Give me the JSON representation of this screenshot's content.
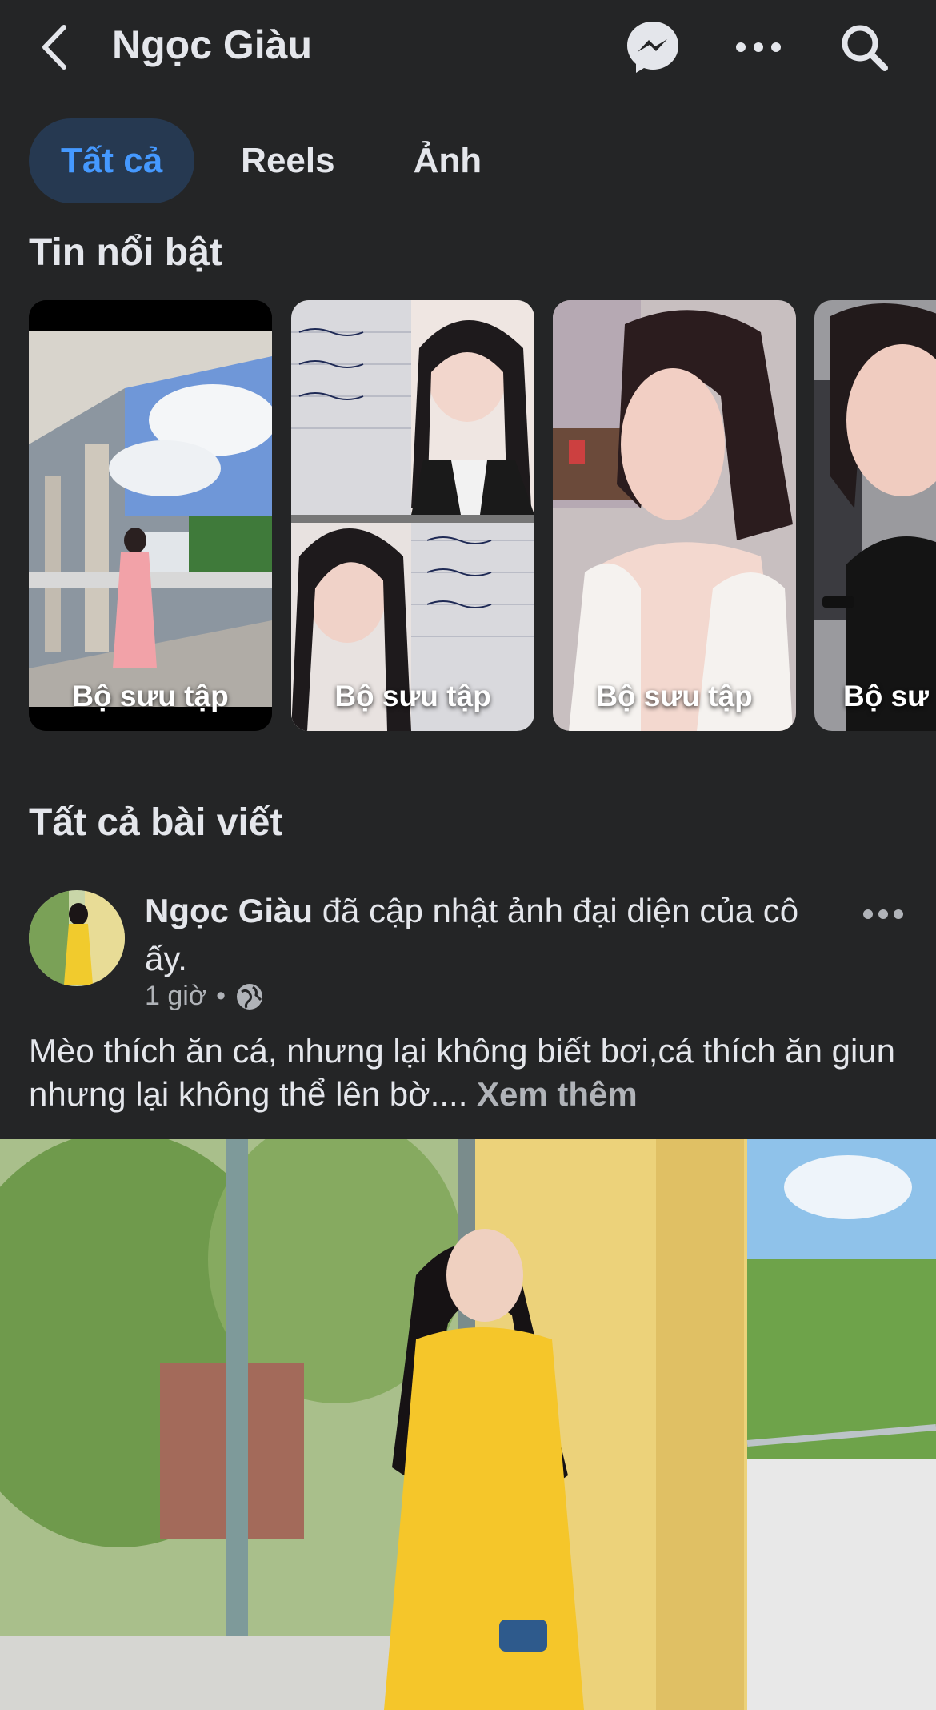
{
  "header": {
    "title": "Ngọc Giàu",
    "icons": [
      "back-chevron-icon",
      "messenger-icon",
      "more-horizontal-icon",
      "search-icon"
    ]
  },
  "tabs": [
    {
      "label": "Tất cả",
      "active": true
    },
    {
      "label": "Reels",
      "active": false
    },
    {
      "label": "Ảnh",
      "active": false
    }
  ],
  "highlights": {
    "title": "Tin nổi bật",
    "items": [
      {
        "label": "Bộ sưu tập"
      },
      {
        "label": "Bộ sưu tập"
      },
      {
        "label": "Bộ sưu tập"
      },
      {
        "label": "Bộ sư"
      }
    ]
  },
  "posts_section": {
    "title": "Tất cả bài viết"
  },
  "post": {
    "author": "Ngọc Giàu",
    "action": " đã cập nhật ảnh đại diện của cô ấy.",
    "time": "1 giờ",
    "audience_icon": "globe-icon",
    "text": "Mèo thích ăn cá, nhưng lại không biết bơi,cá thích ăn giun nhưng lại không thể lên bờ.... ",
    "see_more": "Xem thêm"
  },
  "colors": {
    "background": "#242526",
    "tab_active_bg": "#263951",
    "tab_active_text": "#4599ff",
    "secondary_text": "#b0b3b8"
  }
}
